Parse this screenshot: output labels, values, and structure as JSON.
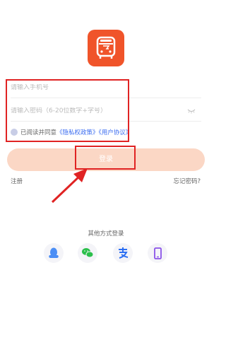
{
  "login": {
    "phone_placeholder": "请输入手机号",
    "password_placeholder": "请输入密码（6-20位数字+字号）",
    "agree_prefix": "已阅读并同意",
    "privacy_link": "《隐私权政策》",
    "user_agreement_link": "《用户协议》",
    "login_button": "登录",
    "register_link": "注册",
    "forgot_link": "忘记密码?"
  },
  "other_login": {
    "title": "其他方式登录",
    "options": [
      "qq-icon",
      "wechat-icon",
      "alipay-icon",
      "phone-icon"
    ]
  },
  "colors": {
    "brand": "#f0542a",
    "button_bg": "#fbd7c5",
    "link": "#3b6cf0",
    "annotation": "#e02323"
  }
}
